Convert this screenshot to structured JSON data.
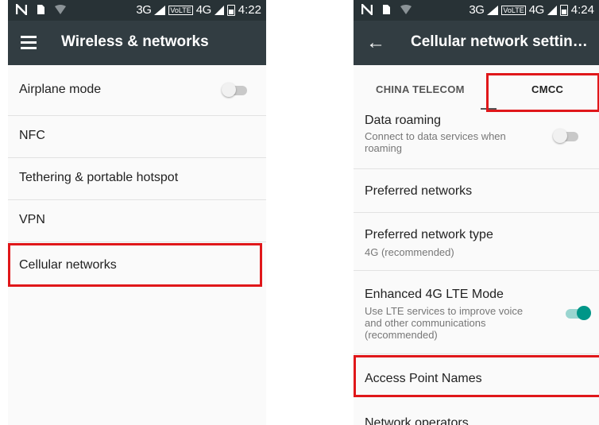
{
  "left": {
    "status": {
      "net": "3G",
      "volte": "VoLTE",
      "lte": "4G",
      "time": "4:22"
    },
    "title": "Wireless & networks",
    "items": [
      {
        "label": "Airplane mode"
      },
      {
        "label": "NFC"
      },
      {
        "label": "Tethering & portable hotspot"
      },
      {
        "label": "VPN"
      },
      {
        "label": "Cellular networks"
      }
    ]
  },
  "right": {
    "status": {
      "net": "3G",
      "volte": "VoLTE",
      "lte": "4G",
      "time": "4:24"
    },
    "title": "Cellular network settin…",
    "tabs": [
      "CHINA TELECOM",
      "CMCC"
    ],
    "items": [
      {
        "label": "Data roaming",
        "sub": "Connect to data services when roaming"
      },
      {
        "label": "Preferred networks"
      },
      {
        "label": "Preferred network type",
        "sub": "4G (recommended)"
      },
      {
        "label": "Enhanced 4G LTE Mode",
        "sub": "Use LTE services to improve voice and other communications (recommended)"
      },
      {
        "label": "Access Point Names"
      },
      {
        "label": "Network operators"
      }
    ]
  },
  "colors": {
    "appbar": "#323d42",
    "statusbar": "#283236",
    "highlight": "#e0171a",
    "toggle_on": "#009688"
  }
}
